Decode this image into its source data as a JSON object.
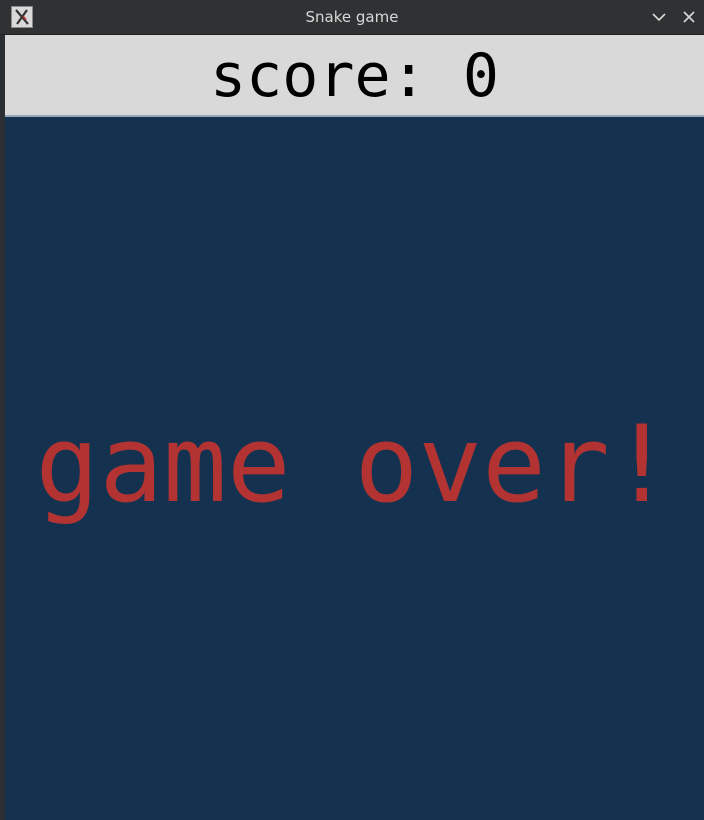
{
  "window": {
    "title": "Snake game",
    "app_icon": "x-app-icon",
    "controls": {
      "minimize_icon": "chevron-down-icon",
      "close_icon": "close-icon"
    }
  },
  "score_bar": {
    "text": "score: 0"
  },
  "game": {
    "message": "game over!",
    "background_color": "#14324f",
    "message_color": "#b23331"
  }
}
